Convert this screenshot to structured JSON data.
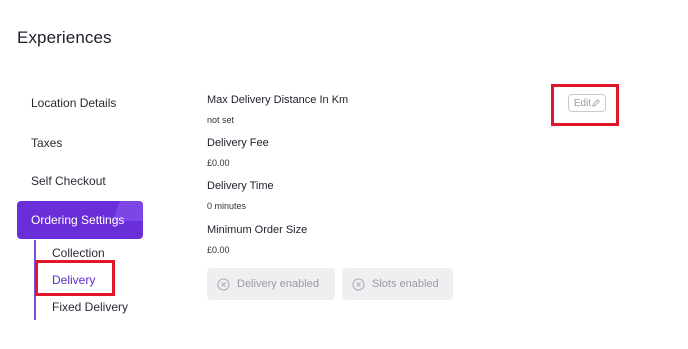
{
  "page": {
    "title": "Experiences"
  },
  "sidebar": {
    "items": [
      {
        "label": "Location Details"
      },
      {
        "label": "Taxes"
      },
      {
        "label": "Self Checkout"
      },
      {
        "label": "Ordering Settings"
      }
    ],
    "sub_items": [
      {
        "label": "Collection"
      },
      {
        "label": "Delivery"
      },
      {
        "label": "Fixed Delivery"
      }
    ]
  },
  "fields": [
    {
      "label": "Max Delivery Distance In Km",
      "value": "not set"
    },
    {
      "label": "Delivery Fee",
      "value": "£0.00"
    },
    {
      "label": "Delivery Time",
      "value": "0 minutes"
    },
    {
      "label": "Minimum Order Size",
      "value": "£0.00"
    }
  ],
  "actions": {
    "edit_label": "Edit"
  },
  "chips": [
    {
      "label": "Delivery enabled",
      "icon": "x-circle-icon"
    },
    {
      "label": "Slots enabled",
      "icon": "x-circle-icon"
    }
  ],
  "colors": {
    "accent": "#6a2ed8",
    "highlight": "#e0162a"
  }
}
